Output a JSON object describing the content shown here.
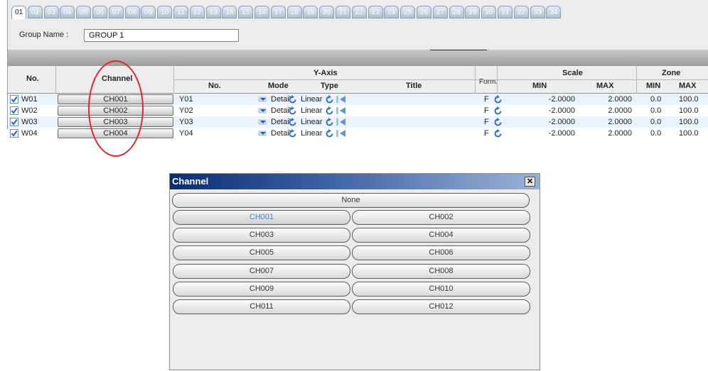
{
  "tabs": [
    "01",
    "02",
    "03",
    "04",
    "05",
    "06",
    "07",
    "08",
    "09",
    "10",
    "11",
    "12",
    "13",
    "14",
    "15",
    "16",
    "17",
    "18",
    "19",
    "20",
    "21",
    "22",
    "23",
    "24",
    "25",
    "26",
    "27",
    "28",
    "29",
    "30",
    "31",
    "32",
    "33",
    "34"
  ],
  "active_tab": "01",
  "group": {
    "label": "Group Name :",
    "value": "GROUP 1"
  },
  "table": {
    "headers": {
      "no": "No.",
      "channel": "Channel",
      "yaxis": "Y-Axis",
      "y_no": "No.",
      "mode": "Mode",
      "type": "Type",
      "title": "Title",
      "form": "Form.",
      "scale": "Scale",
      "scale_min": "MIN",
      "scale_max": "MAX",
      "zone": "Zone",
      "zone_min": "MIN",
      "zone_max": "MAX"
    },
    "rows": [
      {
        "no": "W01",
        "channel": "CH001",
        "y_no": "Y01",
        "mode": "Detail",
        "type": "Linear",
        "form": "F",
        "scale_min": "-2.0000",
        "scale_max": "2.0000",
        "zone_min": "0.0",
        "zone_max": "100.0",
        "checked": true
      },
      {
        "no": "W02",
        "channel": "CH002",
        "y_no": "Y02",
        "mode": "Detail",
        "type": "Linear",
        "form": "F",
        "scale_min": "-2.0000",
        "scale_max": "2.0000",
        "zone_min": "0.0",
        "zone_max": "100.0",
        "checked": true
      },
      {
        "no": "W03",
        "channel": "CH003",
        "y_no": "Y03",
        "mode": "Detail",
        "type": "Linear",
        "form": "F",
        "scale_min": "-2.0000",
        "scale_max": "2.0000",
        "zone_min": "0.0",
        "zone_max": "100.0",
        "checked": true
      },
      {
        "no": "W04",
        "channel": "CH004",
        "y_no": "Y04",
        "mode": "Detail",
        "type": "Linear",
        "form": "F",
        "scale_min": "-2.0000",
        "scale_max": "2.0000",
        "zone_min": "0.0",
        "zone_max": "100.0",
        "checked": true
      }
    ]
  },
  "dialog": {
    "title": "Channel",
    "close": "✕",
    "none_label": "None",
    "selected": "CH001",
    "channels": [
      "CH001",
      "CH002",
      "CH003",
      "CH004",
      "CH005",
      "CH006",
      "CH007",
      "CH008",
      "CH009",
      "CH010",
      "CH011",
      "CH012"
    ]
  },
  "colors": {
    "annotation": "#e0262c",
    "selected_channel": "#3a7fd0",
    "title_bar": "#0a2d6e"
  },
  "icons": {
    "checkbox": "checkmark-icon",
    "dropdown": "dropdown-arrow-icon",
    "refresh": "refresh-icon",
    "marker": "marker-icon",
    "close": "close-icon"
  }
}
